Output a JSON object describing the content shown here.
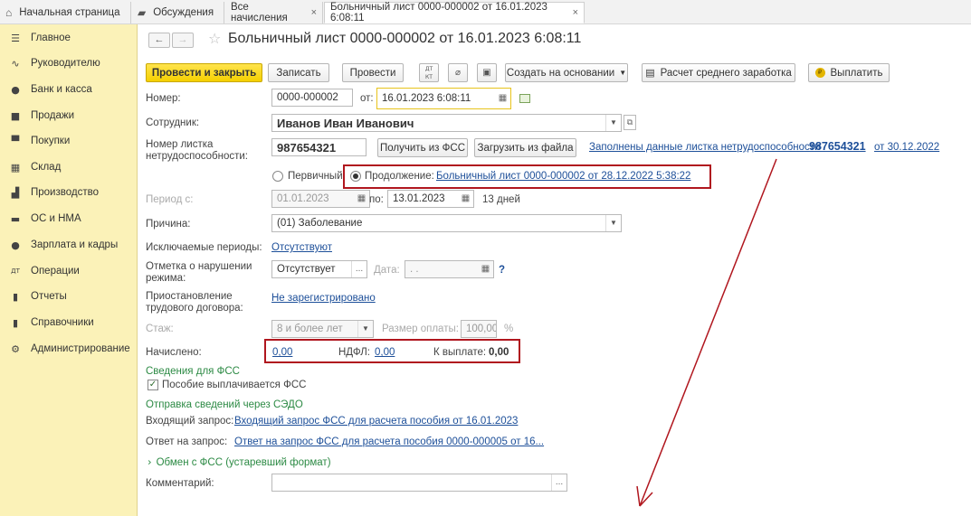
{
  "tabs": [
    {
      "label": "Начальная страница",
      "icon": "home-icon"
    },
    {
      "label": "Обсуждения",
      "icon": "chat-icon"
    },
    {
      "label": "Все начисления",
      "close": "×"
    },
    {
      "label": "Больничный лист 0000-000002 от 16.01.2023 6:08:11",
      "close": "×"
    }
  ],
  "sidebar": {
    "items": [
      {
        "label": "Главное",
        "icon": "menu-icon"
      },
      {
        "label": "Руководителю",
        "icon": "trend-icon"
      },
      {
        "label": "Банк и касса",
        "icon": "ruble-icon"
      },
      {
        "label": "Продажи",
        "icon": "bag-icon"
      },
      {
        "label": "Покупки",
        "icon": "cart-icon"
      },
      {
        "label": "Склад",
        "icon": "warehouse-icon"
      },
      {
        "label": "Производство",
        "icon": "factory-icon"
      },
      {
        "label": "ОС и НМА",
        "icon": "truck-icon"
      },
      {
        "label": "Зарплата и кадры",
        "icon": "person-icon"
      },
      {
        "label": "Операции",
        "icon": "dt-kt-icon"
      },
      {
        "label": "Отчеты",
        "icon": "bar-chart-icon"
      },
      {
        "label": "Справочники",
        "icon": "book-icon"
      },
      {
        "label": "Администрирование",
        "icon": "gear-icon"
      }
    ]
  },
  "doc": {
    "title": "Больничный лист 0000-000002 от 16.01.2023 6:08:11",
    "nav_back": "←",
    "nav_forward": "→"
  },
  "toolbar": {
    "post_close": "Провести и закрыть",
    "save": "Записать",
    "post": "Провести",
    "dtkt": "ДТ КТ",
    "create_based": "Создать на основании",
    "avg_calc": "Расчет среднего заработка",
    "pay": "Выплатить"
  },
  "form": {
    "number_label": "Номер:",
    "number": "0000-000002",
    "from_label": "от:",
    "date": "16.01.2023  6:08:11",
    "employee_label": "Сотрудник:",
    "employee": "Иванов Иван Иванович",
    "sheet_label": "Номер листка нетрудоспособности:",
    "sheet_number": "987654321",
    "get_fss": "Получить из ФСС",
    "load_file": "Загрузить из файла",
    "filled_link": "Заполнены данные листка нетрудоспособности",
    "filled_number": "987654321",
    "filled_date": "от 30.12.2022",
    "primary_label": "Первичный",
    "continuation_label": "Продолжение:",
    "continuation_link": "Больничный лист 0000-000002 от 28.12.2022 5:38:22",
    "period_label": "Период с:",
    "period_from": "01.01.2023",
    "period_to_label": "по:",
    "period_to": "13.01.2023",
    "days": "13 дней",
    "reason_label": "Причина:",
    "reason": "(01) Заболевание",
    "excluded_label": "Исключаемые периоды:",
    "excluded_value": "Отсутствуют",
    "violation_label": "Отметка о нарушении режима:",
    "violation_value": "Отсутствует",
    "violation_date_label": "Дата:",
    "violation_date": ". .",
    "help": "?",
    "suspension_label": "Приостановление трудового договора:",
    "suspension_value": "Не зарегистрировано",
    "experience_label": "Стаж:",
    "experience": "8 и более лет",
    "pay_size_label": "Размер оплаты:",
    "pay_size": "100,00",
    "percent": "%",
    "accrued_label": "Начислено:",
    "accrued": "0,00",
    "ndfl_label": "НДФЛ:",
    "ndfl": "0,00",
    "payout_label": "К выплате:",
    "payout": "0,00",
    "fss_section": "Сведения для ФСС",
    "fss_paid_label": "Пособие выплачивается ФСС",
    "sedo_section": "Отправка сведений через СЭДО",
    "incoming_label": "Входящий запрос:",
    "incoming_link": "Входящий запрос ФСС для расчета пособия  от 16.01.2023",
    "answer_label": "Ответ на запрос:",
    "answer_link": "Ответ на запрос ФСС для расчета пособия 0000-000005 от 16...",
    "exchange_label": "Обмен с ФСС (устаревший формат)",
    "comment_label": "Комментарий:",
    "comment": "",
    "ellipsis": "..."
  },
  "colors": {
    "accent": "#f5d000",
    "sidebar": "#fbf2b8",
    "annotation": "#b0161e",
    "link": "#1d4f99",
    "section": "#2c8a44"
  }
}
